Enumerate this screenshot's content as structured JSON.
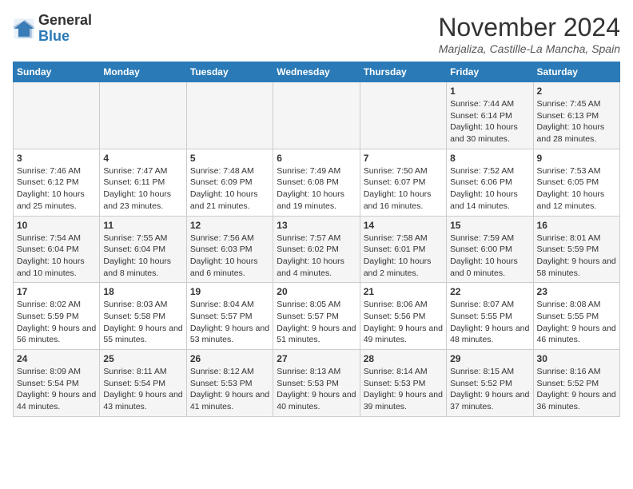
{
  "header": {
    "logo_general": "General",
    "logo_blue": "Blue",
    "month_title": "November 2024",
    "location": "Marjaliza, Castille-La Mancha, Spain"
  },
  "days_of_week": [
    "Sunday",
    "Monday",
    "Tuesday",
    "Wednesday",
    "Thursday",
    "Friday",
    "Saturday"
  ],
  "weeks": [
    [
      {
        "day": "",
        "info": ""
      },
      {
        "day": "",
        "info": ""
      },
      {
        "day": "",
        "info": ""
      },
      {
        "day": "",
        "info": ""
      },
      {
        "day": "",
        "info": ""
      },
      {
        "day": "1",
        "info": "Sunrise: 7:44 AM\nSunset: 6:14 PM\nDaylight: 10 hours and 30 minutes."
      },
      {
        "day": "2",
        "info": "Sunrise: 7:45 AM\nSunset: 6:13 PM\nDaylight: 10 hours and 28 minutes."
      }
    ],
    [
      {
        "day": "3",
        "info": "Sunrise: 7:46 AM\nSunset: 6:12 PM\nDaylight: 10 hours and 25 minutes."
      },
      {
        "day": "4",
        "info": "Sunrise: 7:47 AM\nSunset: 6:11 PM\nDaylight: 10 hours and 23 minutes."
      },
      {
        "day": "5",
        "info": "Sunrise: 7:48 AM\nSunset: 6:09 PM\nDaylight: 10 hours and 21 minutes."
      },
      {
        "day": "6",
        "info": "Sunrise: 7:49 AM\nSunset: 6:08 PM\nDaylight: 10 hours and 19 minutes."
      },
      {
        "day": "7",
        "info": "Sunrise: 7:50 AM\nSunset: 6:07 PM\nDaylight: 10 hours and 16 minutes."
      },
      {
        "day": "8",
        "info": "Sunrise: 7:52 AM\nSunset: 6:06 PM\nDaylight: 10 hours and 14 minutes."
      },
      {
        "day": "9",
        "info": "Sunrise: 7:53 AM\nSunset: 6:05 PM\nDaylight: 10 hours and 12 minutes."
      }
    ],
    [
      {
        "day": "10",
        "info": "Sunrise: 7:54 AM\nSunset: 6:04 PM\nDaylight: 10 hours and 10 minutes."
      },
      {
        "day": "11",
        "info": "Sunrise: 7:55 AM\nSunset: 6:04 PM\nDaylight: 10 hours and 8 minutes."
      },
      {
        "day": "12",
        "info": "Sunrise: 7:56 AM\nSunset: 6:03 PM\nDaylight: 10 hours and 6 minutes."
      },
      {
        "day": "13",
        "info": "Sunrise: 7:57 AM\nSunset: 6:02 PM\nDaylight: 10 hours and 4 minutes."
      },
      {
        "day": "14",
        "info": "Sunrise: 7:58 AM\nSunset: 6:01 PM\nDaylight: 10 hours and 2 minutes."
      },
      {
        "day": "15",
        "info": "Sunrise: 7:59 AM\nSunset: 6:00 PM\nDaylight: 10 hours and 0 minutes."
      },
      {
        "day": "16",
        "info": "Sunrise: 8:01 AM\nSunset: 5:59 PM\nDaylight: 9 hours and 58 minutes."
      }
    ],
    [
      {
        "day": "17",
        "info": "Sunrise: 8:02 AM\nSunset: 5:59 PM\nDaylight: 9 hours and 56 minutes."
      },
      {
        "day": "18",
        "info": "Sunrise: 8:03 AM\nSunset: 5:58 PM\nDaylight: 9 hours and 55 minutes."
      },
      {
        "day": "19",
        "info": "Sunrise: 8:04 AM\nSunset: 5:57 PM\nDaylight: 9 hours and 53 minutes."
      },
      {
        "day": "20",
        "info": "Sunrise: 8:05 AM\nSunset: 5:57 PM\nDaylight: 9 hours and 51 minutes."
      },
      {
        "day": "21",
        "info": "Sunrise: 8:06 AM\nSunset: 5:56 PM\nDaylight: 9 hours and 49 minutes."
      },
      {
        "day": "22",
        "info": "Sunrise: 8:07 AM\nSunset: 5:55 PM\nDaylight: 9 hours and 48 minutes."
      },
      {
        "day": "23",
        "info": "Sunrise: 8:08 AM\nSunset: 5:55 PM\nDaylight: 9 hours and 46 minutes."
      }
    ],
    [
      {
        "day": "24",
        "info": "Sunrise: 8:09 AM\nSunset: 5:54 PM\nDaylight: 9 hours and 44 minutes."
      },
      {
        "day": "25",
        "info": "Sunrise: 8:11 AM\nSunset: 5:54 PM\nDaylight: 9 hours and 43 minutes."
      },
      {
        "day": "26",
        "info": "Sunrise: 8:12 AM\nSunset: 5:53 PM\nDaylight: 9 hours and 41 minutes."
      },
      {
        "day": "27",
        "info": "Sunrise: 8:13 AM\nSunset: 5:53 PM\nDaylight: 9 hours and 40 minutes."
      },
      {
        "day": "28",
        "info": "Sunrise: 8:14 AM\nSunset: 5:53 PM\nDaylight: 9 hours and 39 minutes."
      },
      {
        "day": "29",
        "info": "Sunrise: 8:15 AM\nSunset: 5:52 PM\nDaylight: 9 hours and 37 minutes."
      },
      {
        "day": "30",
        "info": "Sunrise: 8:16 AM\nSunset: 5:52 PM\nDaylight: 9 hours and 36 minutes."
      }
    ]
  ]
}
